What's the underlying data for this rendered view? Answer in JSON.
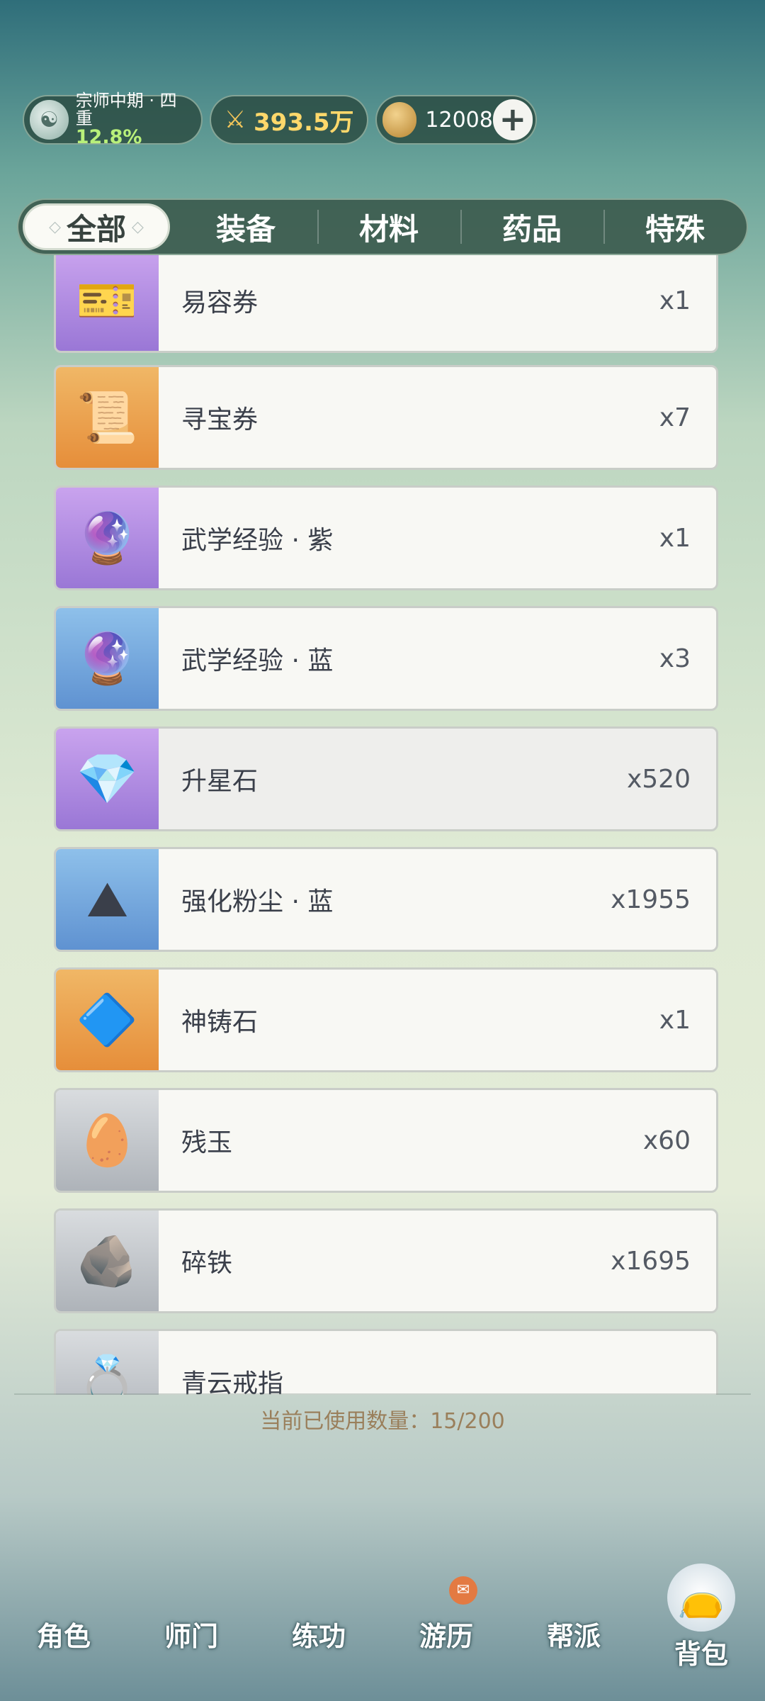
{
  "header": {
    "realm": {
      "title": "宗师中期 · 四重",
      "percent": "12.8%",
      "icon": "hero-avatar-icon"
    },
    "power": {
      "value": "393.5万",
      "icon": "crossed-swords-icon"
    },
    "coins": {
      "value": "12008",
      "icon": "coin-icon",
      "add_label": "+"
    }
  },
  "tabs": [
    {
      "label": "全部",
      "active": true
    },
    {
      "label": "装备",
      "active": false
    },
    {
      "label": "材料",
      "active": false
    },
    {
      "label": "药品",
      "active": false
    },
    {
      "label": "特殊",
      "active": false
    }
  ],
  "items": [
    {
      "name": "易容券",
      "count": "x1",
      "quality": "purple",
      "icon": "ticket-icon",
      "glyph": "🎫"
    },
    {
      "name": "寻宝券",
      "count": "x7",
      "quality": "orange",
      "icon": "scroll-icon",
      "glyph": "📜"
    },
    {
      "name": "武学经验 · 紫",
      "count": "x1",
      "quality": "purple",
      "icon": "experience-orb-icon",
      "glyph": "🔮"
    },
    {
      "name": "武学经验 · 蓝",
      "count": "x3",
      "quality": "blue",
      "icon": "experience-orb-icon",
      "glyph": "🔮"
    },
    {
      "name": "升星石",
      "count": "x520",
      "quality": "purple",
      "icon": "crystal-icon",
      "glyph": "💎",
      "selected": true
    },
    {
      "name": "强化粉尘 · 蓝",
      "count": "x1955",
      "quality": "blue",
      "icon": "dust-box-icon",
      "glyph": "⛰"
    },
    {
      "name": "神铸石",
      "count": "x1",
      "quality": "orange",
      "icon": "forge-stone-icon",
      "glyph": "🔷"
    },
    {
      "name": "残玉",
      "count": "x60",
      "quality": "gray",
      "icon": "jade-icon",
      "glyph": "🥚"
    },
    {
      "name": "碎铁",
      "count": "x1695",
      "quality": "gray",
      "icon": "iron-ore-icon",
      "glyph": "🪨"
    },
    {
      "name": "青云戒指",
      "count": "",
      "quality": "gray",
      "icon": "ring-icon",
      "glyph": "💍"
    }
  ],
  "capacity": "当前已使用数量：15/200",
  "nav": [
    {
      "label": "角色",
      "badge": ""
    },
    {
      "label": "师门",
      "badge": ""
    },
    {
      "label": "练功",
      "badge": ""
    },
    {
      "label": "游历",
      "badge": "✉",
      "badge_icon": "chest-notification-icon"
    },
    {
      "label": "帮派",
      "badge": ""
    },
    {
      "label": "背包",
      "badge": "",
      "active": true,
      "icon": "bag-icon"
    }
  ]
}
